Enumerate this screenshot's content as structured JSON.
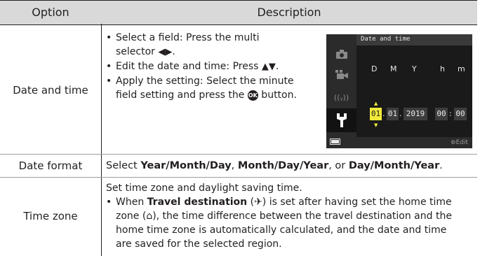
{
  "header": {
    "option": "Option",
    "description": "Description"
  },
  "rows": [
    {
      "option": "Date and time",
      "bullets": [
        {
          "line1": "Select a field: Press the multi",
          "line2_text": "selector ",
          "line2_glyph": "◀▶",
          "line2_end": "."
        },
        {
          "text": "Edit the date and time: Press ",
          "glyph": "▲▼",
          "end": "."
        },
        {
          "line1": "Apply the setting: Select the minute",
          "line2_pre": "field setting and press the ",
          "ok_label": "OK",
          "line2_end": " button."
        }
      ],
      "screen": {
        "title": "Date and time",
        "menu_icons": [
          "camera-icon",
          "movie-icon",
          "wireless-icon",
          "wrench-icon"
        ],
        "columns": [
          "D",
          "M",
          "Y",
          "h",
          "m"
        ],
        "day": "01",
        "month": "01",
        "year": "2019",
        "hour": "00",
        "minute": "00",
        "edit_label": "Edit"
      }
    },
    {
      "option": "Date format",
      "parts": {
        "pre": "Select ",
        "opt1": "Year/Month/Day",
        "sep1": ", ",
        "opt2": "Month/Day/Year",
        "sep2": ", or ",
        "opt3": "Day/Month/Year",
        "end": "."
      }
    },
    {
      "option": "Time zone",
      "intro": "Set time zone and daylight saving time.",
      "bullet": {
        "pre": "When ",
        "bold": "Travel destination",
        "l1_rest": " (✈) is set after having set the home time",
        "l2": "zone (⌂), the time difference between the travel destination and the",
        "l3": "home time zone is automatically calculated, and the date and time",
        "l4": "are saved for the selected region."
      }
    }
  ],
  "colors": {
    "header_bg": "#d9d9d9",
    "screen_highlight": "#f2ea3a"
  }
}
